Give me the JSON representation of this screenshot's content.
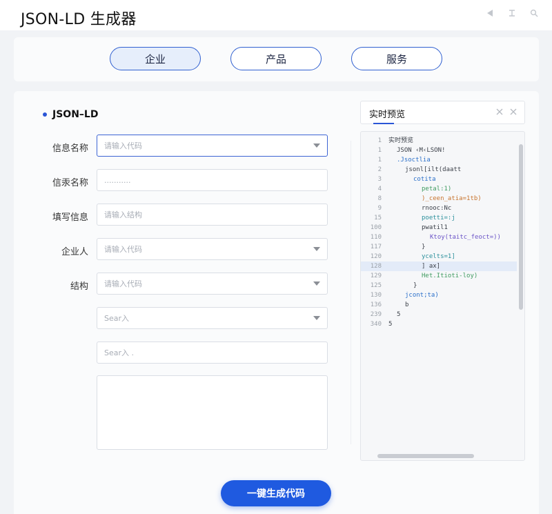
{
  "app": {
    "title": "JSON-LD 生成器"
  },
  "window_controls": [
    "back-icon",
    "minimize-icon",
    "search-icon"
  ],
  "tabs": [
    {
      "label": "企业",
      "active": true
    },
    {
      "label": "产品",
      "active": false
    },
    {
      "label": "服务",
      "active": false
    }
  ],
  "form": {
    "section_title": "JSON–LD",
    "fields": [
      {
        "label": "信息名称",
        "placeholder": "请输入代码",
        "type": "select"
      },
      {
        "label": "信汞名称",
        "placeholder": "...........",
        "type": "text"
      },
      {
        "label": "填写信息",
        "placeholder": "请输入结构",
        "type": "text"
      },
      {
        "label": "企业人",
        "placeholder": "请输入代码",
        "type": "select"
      },
      {
        "label": "结构",
        "placeholder": "请输入代码",
        "type": "select"
      },
      {
        "label": "",
        "placeholder": "Sear入",
        "type": "select"
      },
      {
        "label": "",
        "placeholder": "Sear入 .",
        "type": "text"
      }
    ],
    "generate_button": "一键生成代码"
  },
  "preview": {
    "title": "实时预览",
    "lines": [
      {
        "num": "1",
        "text": "实时预览",
        "color": "dark"
      },
      {
        "num": "1",
        "text": "JSON ‹M‹LSON!",
        "color": "dark"
      },
      {
        "num": "1",
        "text": ".Jsoctlia",
        "color": "blue"
      },
      {
        "num": "2",
        "text": "jsonl[ilt(daatt",
        "color": "dark"
      },
      {
        "num": "3",
        "text": "cotita",
        "color": "blue"
      },
      {
        "num": "4",
        "text": "petal:1)",
        "color": "green"
      },
      {
        "num": "8",
        "text": ")_ceen_atia=1tb)",
        "color": "orange"
      },
      {
        "num": "9",
        "text": "rnooc:Nc",
        "color": "dark"
      },
      {
        "num": "15",
        "text": "poetti=:j",
        "color": "teal"
      },
      {
        "num": "100",
        "text": "pwatil1",
        "color": "dark"
      },
      {
        "num": "110",
        "text": "Ktoy(taitc_feoct=))",
        "color": "violet"
      },
      {
        "num": "117",
        "text": "}",
        "color": "dark"
      },
      {
        "num": "120",
        "text": "ycelts=1]",
        "color": "teal"
      },
      {
        "num": "128",
        "text": "] ax]",
        "color": "dark"
      },
      {
        "num": "129",
        "text": "Het.Itioti-loy)",
        "color": "green"
      },
      {
        "num": "125",
        "text": "}",
        "color": "dark"
      },
      {
        "num": "130",
        "text": "jcont;ta)",
        "color": "blue"
      },
      {
        "num": "136",
        "text": "b",
        "color": "dark"
      },
      {
        "num": "239",
        "text": "5",
        "color": "dark"
      },
      {
        "num": "340",
        "text": "5",
        "color": "dark"
      }
    ]
  }
}
